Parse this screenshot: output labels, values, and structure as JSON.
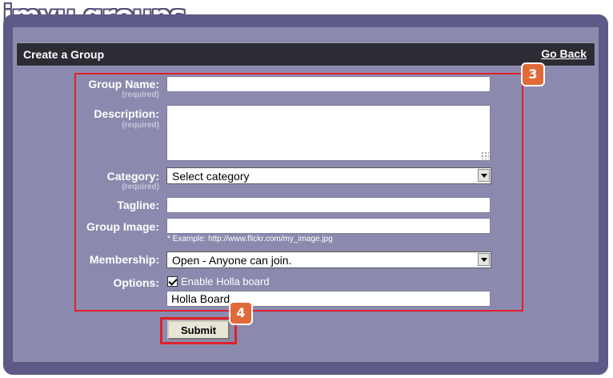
{
  "header": {
    "logo_text": "imvu groups"
  },
  "titlebar": {
    "title": "Create a Group",
    "go_back": "Go Back"
  },
  "badges": {
    "form_badge": "3",
    "submit_badge": "4"
  },
  "highlight_color": "#e0202a",
  "form": {
    "required_note": "(required)",
    "group_name": {
      "label": "Group Name:",
      "value": ""
    },
    "description": {
      "label": "Description:",
      "value": ""
    },
    "category": {
      "label": "Category:",
      "selected": "Select category"
    },
    "tagline": {
      "label": "Tagline:",
      "value": ""
    },
    "group_image": {
      "label": "Group Image:",
      "value": "",
      "hint": "* Example: http://www.flickr.com/my_image.jpg"
    },
    "membership": {
      "label": "Membership:",
      "selected": "Open - Anyone can join."
    },
    "options": {
      "label": "Options:",
      "enable_holla_label": "Enable Holla board",
      "holla_board_value": "Holla Board"
    },
    "submit_label": "Submit"
  }
}
